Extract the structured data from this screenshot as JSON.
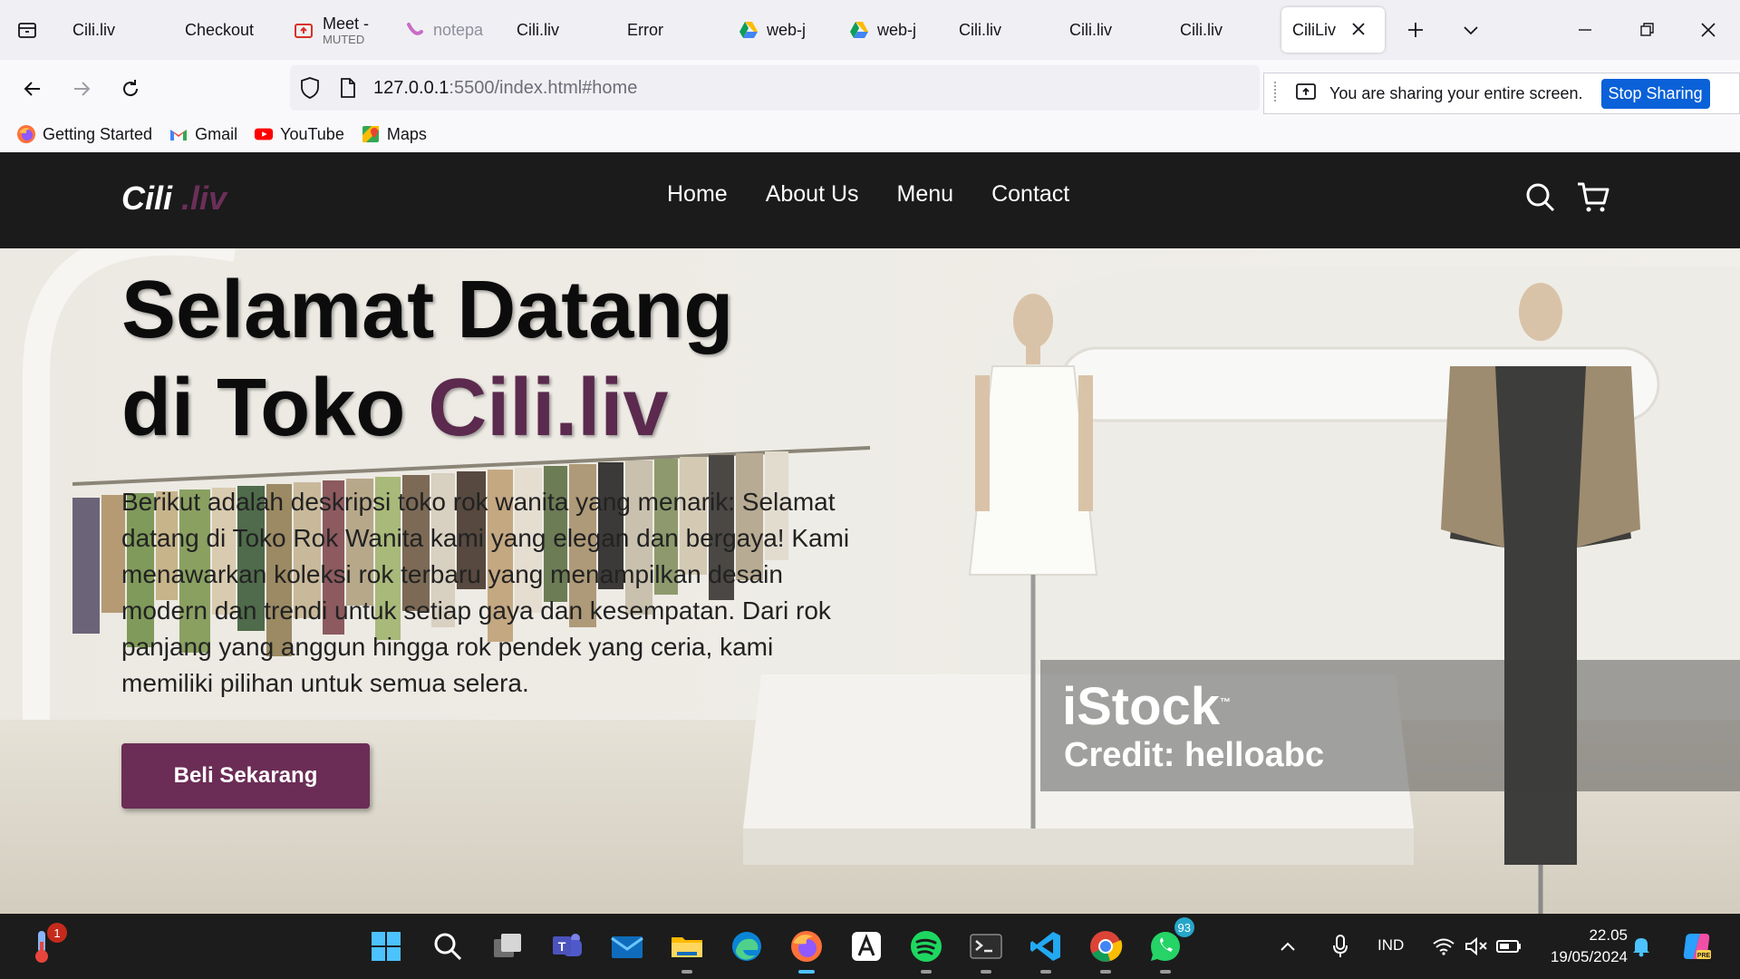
{
  "browser": {
    "tabs": [
      {
        "label": "Cili.liv",
        "icon": "none"
      },
      {
        "label": "Checkout",
        "icon": "none"
      },
      {
        "label": "Meet -",
        "sublabel": "MUTED",
        "icon": "meet-present-icon"
      },
      {
        "label": "notepa",
        "icon": "notepad-icon"
      },
      {
        "label": "Cili.liv",
        "icon": "none"
      },
      {
        "label": "Error",
        "icon": "none"
      },
      {
        "label": "web-j",
        "icon": "google-drive-icon"
      },
      {
        "label": "web-j",
        "icon": "google-drive-icon"
      },
      {
        "label": "Cili.liv",
        "icon": "none"
      },
      {
        "label": "Cili.liv",
        "icon": "none"
      },
      {
        "label": "Cili.liv",
        "icon": "none"
      },
      {
        "label": "CiliLiv",
        "icon": "none",
        "active": true
      }
    ],
    "url_host": "127.0.0.1",
    "url_path": ":5500/index.html#home",
    "share_notice": "You are sharing your entire screen.",
    "stop_sharing_label": "Stop Sharing",
    "bookmarks": [
      {
        "label": "Getting Started",
        "icon": "firefox-icon"
      },
      {
        "label": "Gmail",
        "icon": "gmail-icon"
      },
      {
        "label": "YouTube",
        "icon": "youtube-icon"
      },
      {
        "label": "Maps",
        "icon": "maps-icon"
      }
    ]
  },
  "site": {
    "logo_main": "Cili",
    "logo_accent": " .liv",
    "menu": [
      "Home",
      "About Us",
      "Menu",
      "Contact"
    ],
    "hero_title_line1": "Selamat Datang",
    "hero_title_line2_prefix": "di Toko ",
    "hero_title_line2_accent": "Cili.liv",
    "hero_description": "Berikut adalah deskripsi toko rok wanita yang menarik: Selamat datang di Toko Rok Wanita kami yang elegan dan bergaya! Kami menawarkan koleksi rok terbaru yang menampilkan desain modern dan trendi untuk setiap gaya dan kesempatan. Dari rok panjang yang anggun hingga rok pendek yang ceria, kami memiliki pilihan untuk semua selera.",
    "cta_label": "Beli Sekarang",
    "watermark_brand": "iStock",
    "watermark_tm": "™",
    "watermark_credit": "Credit: helloabc",
    "colors": {
      "accent": "#6b2d56",
      "header_bg": "#1b1b1b"
    }
  },
  "taskbar": {
    "weather_badge": "1",
    "whatsapp_badge": "93",
    "language": "IND",
    "time": "22.05",
    "date": "19/05/2024",
    "apps": [
      "start-icon",
      "search-icon",
      "task-view-icon",
      "teams-icon",
      "mail-icon",
      "file-explorer-icon",
      "edge-icon",
      "firefox-icon",
      "affinity-icon",
      "spotify-icon",
      "terminal-icon",
      "vscode-icon",
      "chrome-icon",
      "whatsapp-icon"
    ]
  }
}
